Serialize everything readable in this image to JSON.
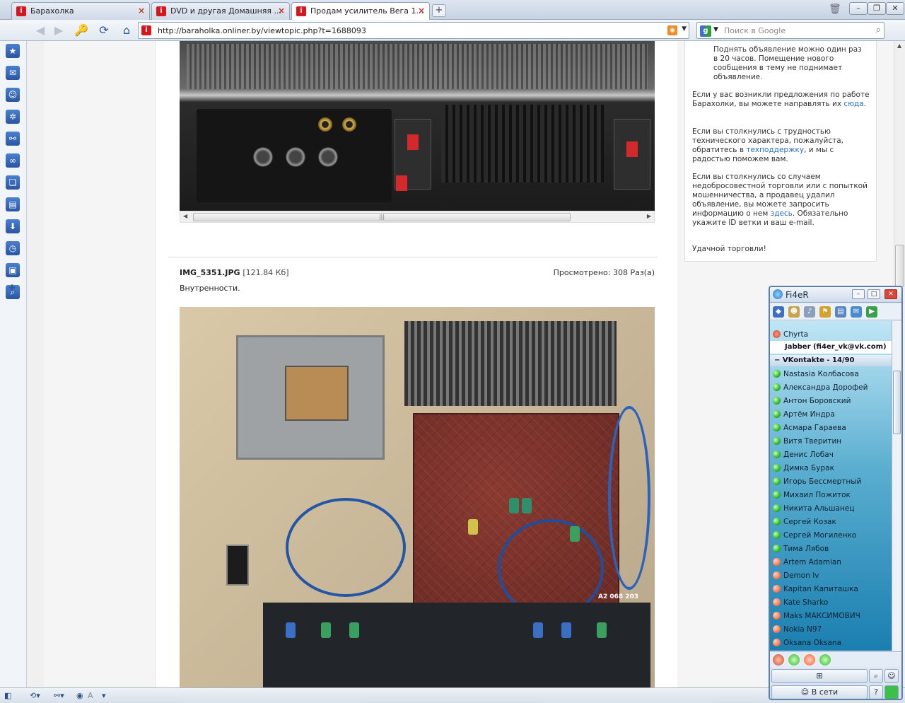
{
  "tabs": [
    {
      "label": "Барахолка"
    },
    {
      "label": "DVD и другая Домашняя ..."
    },
    {
      "label": "Продам усилитель Вега 1..."
    }
  ],
  "address": {
    "url": "http://baraholka.onliner.by/viewtopic.php?t=1688093"
  },
  "search": {
    "placeholder": "Поиск в Google"
  },
  "post": {
    "file_name": "IMG_5351.JPG",
    "file_size": "[121.84 Кб]",
    "views": "Просмотрено: 308 Раз(а)",
    "caption": "Внутренности.",
    "photo_board_mark": "A2 068 203"
  },
  "info": {
    "cont": "Поднять объявление можно один раз в 20 часов. Помещение нового сообщения в тему не поднимает объявление.",
    "p1_pre": "Если у вас возникли предложения по работе Барахолки, вы можете направлять их ",
    "p1_link": "сюда",
    "p1_post": ".",
    "p2_pre": "Если вы столкнулись с трудностью технического характера, пожалуйста, обратитесь в ",
    "p2_link": "техподдержку",
    "p2_post": ", и мы с радостью поможем вам.",
    "p3_pre": "Если вы столкнулись со случаем недобросовестной торговли или с попыткой мошенничества, а продавец удалил объявление, вы можете запросить информацию о нем ",
    "p3_link": "здесь",
    "p3_post": ". Обязательно укажите ID ветки и ваш e-mail.",
    "p4": "Удачной торговли!"
  },
  "im": {
    "title": "Fi4eR",
    "chyrta": "Chyrta",
    "jabber": "Jabber (fi4er_vk@vk.com)",
    "group": "VKontakte - 14/90",
    "status_button": "В сети",
    "contacts": [
      {
        "name": "Nastasia Колбасова",
        "online": true
      },
      {
        "name": "Александра Дорофей",
        "online": true
      },
      {
        "name": "Антон Боровский",
        "online": true
      },
      {
        "name": "Артём Индра",
        "online": true
      },
      {
        "name": "Асмара Гараева",
        "online": true
      },
      {
        "name": "Витя Тверитин",
        "online": true
      },
      {
        "name": "Денис Лобач",
        "online": true
      },
      {
        "name": "Димка Бурак",
        "online": true
      },
      {
        "name": "Игорь Бессмертный",
        "online": true
      },
      {
        "name": "Михаил Пожиток",
        "online": true
      },
      {
        "name": "Никита Альшанец",
        "online": true
      },
      {
        "name": "Сергей Козак",
        "online": true
      },
      {
        "name": "Сергей Могиленко",
        "online": true
      },
      {
        "name": "Тима Лябов",
        "online": true
      },
      {
        "name": "Artem Adamian",
        "online": false
      },
      {
        "name": "Demon Iv",
        "online": false
      },
      {
        "name": "Kapitan Капиташка",
        "online": false
      },
      {
        "name": "Kate Sharko",
        "online": false
      },
      {
        "name": "Maks МАКСИМОВИЧ",
        "online": false
      },
      {
        "name": "Nokia N97",
        "online": false
      },
      {
        "name": "Oksana Oksana",
        "online": false
      }
    ]
  },
  "statusbar": {
    "zoom_label": "A"
  },
  "colors": {
    "accent": "#2a6fb8",
    "onliner_red": "#d8161d"
  }
}
